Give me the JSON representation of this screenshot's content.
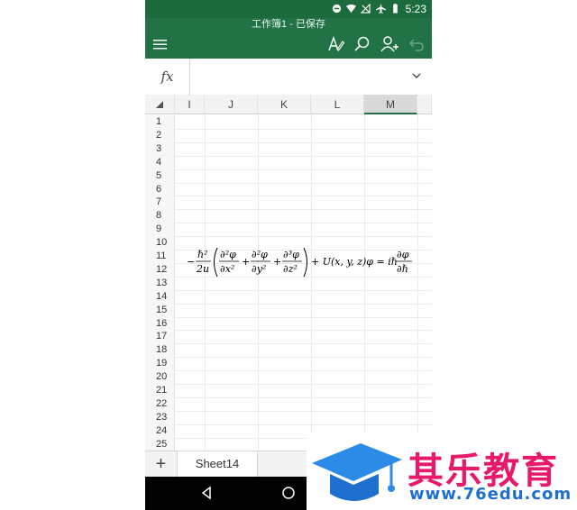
{
  "status_bar": {
    "time": "5:23"
  },
  "app_bar": {
    "title": "工作簿1 - 已保存"
  },
  "formula_bar": {
    "fx_label": "fx",
    "value": ""
  },
  "grid": {
    "columns": [
      "I",
      "J",
      "K",
      "L",
      "M"
    ],
    "selected_column": "M",
    "rows": [
      "1",
      "2",
      "3",
      "4",
      "5",
      "6",
      "7",
      "8",
      "9",
      "10",
      "11",
      "12",
      "13",
      "14",
      "15",
      "16",
      "17",
      "18",
      "19",
      "20",
      "21",
      "22",
      "23",
      "24",
      "25"
    ]
  },
  "equation": {
    "minus": "−",
    "frac1_num": "ℏ²",
    "frac1_den": "2u",
    "d1_num": "∂²φ",
    "d1_den": "∂x²",
    "plus1": "+",
    "d2_num": "∂²φ",
    "d2_den": "∂y²",
    "plus2": "+",
    "d3_num": "∂³φ",
    "d3_den": "∂z²",
    "rest": "+ U(x, y, z)φ = iℏ",
    "rhs_num": "∂φ",
    "rhs_den": "∂ℏ"
  },
  "sheet_bar": {
    "add_label": "+",
    "active_sheet": "Sheet14"
  },
  "watermark": {
    "brand": "其乐教育",
    "url": "www.76edu.com"
  },
  "colors": {
    "accent": "#217346",
    "status": "#1c6b3c",
    "watermark_pink": "#e8196b",
    "watermark_blue": "#1f6fcf"
  }
}
